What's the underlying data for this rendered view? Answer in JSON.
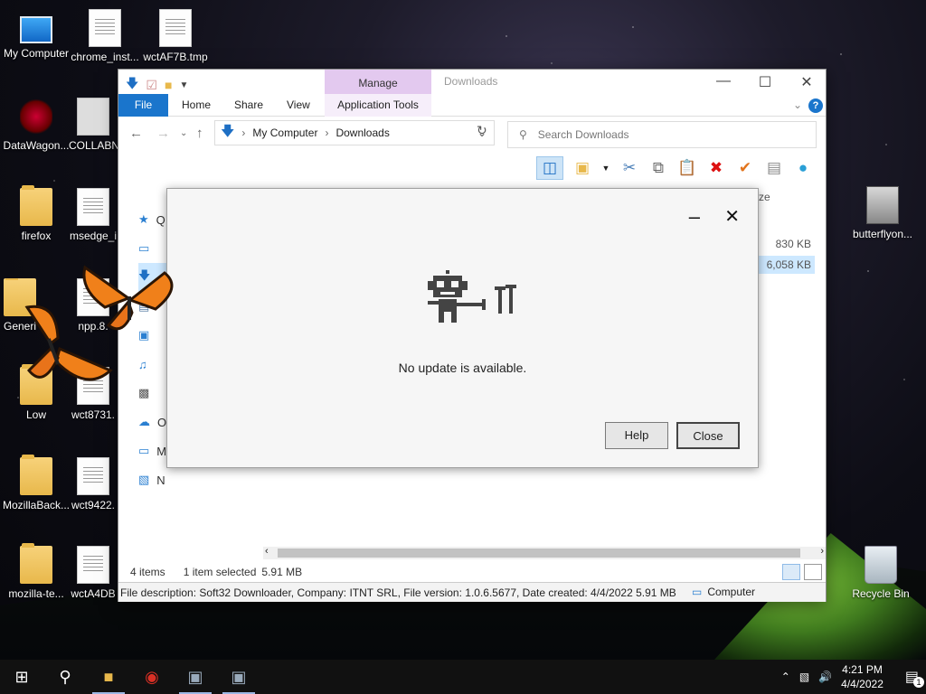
{
  "desktop": {
    "icons": [
      {
        "label": "My Computer"
      },
      {
        "label": "chrome_inst..."
      },
      {
        "label": "wctAF7B.tmp"
      },
      {
        "label": "DataWagon..."
      },
      {
        "label": "COLLABN"
      },
      {
        "label": "firefox"
      },
      {
        "label": "msedge_i"
      },
      {
        "label": "butterflyon..."
      },
      {
        "label": "Generi"
      },
      {
        "label": "npp.8."
      },
      {
        "label": "Low"
      },
      {
        "label": "wct8731."
      },
      {
        "label": "MozillaBack..."
      },
      {
        "label": "wct9422."
      },
      {
        "label": "mozilla-te..."
      },
      {
        "label": "wctA4DB"
      },
      {
        "label": "Recycle Bin"
      }
    ]
  },
  "explorer": {
    "context_tab": "Manage",
    "title": "Downloads",
    "tabs": [
      "File",
      "Home",
      "Share",
      "View",
      "Application Tools"
    ],
    "breadcrumb": [
      "My Computer",
      "Downloads"
    ],
    "search_placeholder": "Search Downloads",
    "size_header": "ze",
    "file_sizes": [
      "830 KB",
      "6,058 KB"
    ],
    "sidebar_letters": [
      "Q",
      "",
      "",
      "",
      "",
      "",
      "",
      "O",
      "M",
      "N"
    ],
    "status": {
      "items": "4 items",
      "selected": "1 item selected",
      "size": "5.91 MB"
    },
    "details": {
      "description": "File description: Soft32 Downloader, Company: ITNT SRL, File version: 1.0.6.5677, Date created: 4/4/2022  5.91 MB",
      "location": "Computer"
    }
  },
  "dialog": {
    "message": "No update is available.",
    "help_label": "Help",
    "close_label": "Close"
  },
  "taskbar": {
    "time": "4:21 PM",
    "date": "4/4/2022",
    "notification_count": "1"
  }
}
